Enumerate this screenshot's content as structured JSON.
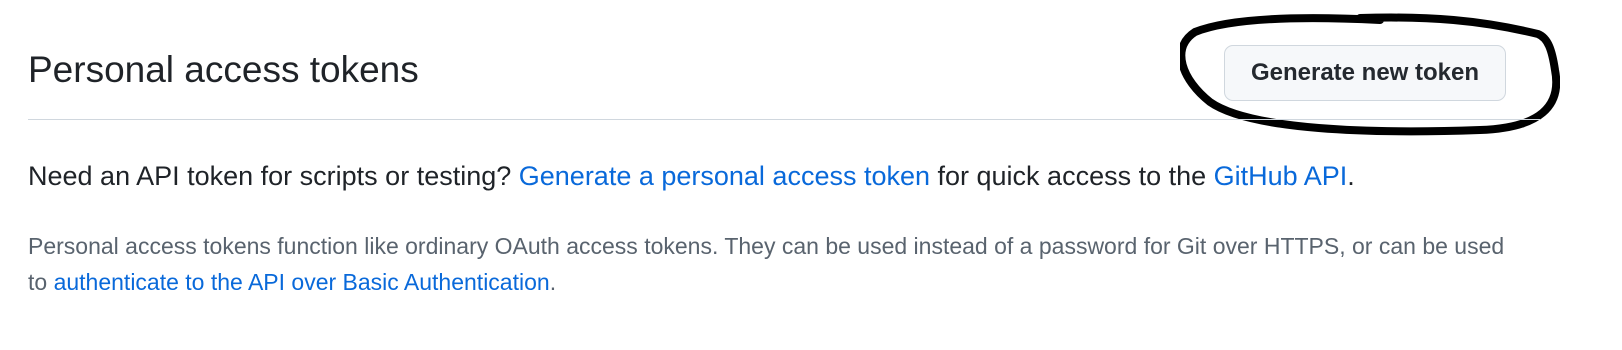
{
  "header": {
    "title": "Personal access tokens",
    "generate_button_label": "Generate new token"
  },
  "intro": {
    "prefix": "Need an API token for scripts or testing? ",
    "link1_label": "Generate a personal access token",
    "middle": " for quick access to the ",
    "link2_label": "GitHub API",
    "suffix": "."
  },
  "note": {
    "text1": "Personal access tokens function like ordinary OAuth access tokens. They can be used instead of a password for Git over HTTPS, or can be used to ",
    "link_label": "authenticate to the API over Basic Authentication",
    "suffix": "."
  },
  "colors": {
    "link": "#0969da",
    "muted_text": "#59636e",
    "divider": "#d0d7de",
    "annotation": "#000000"
  }
}
